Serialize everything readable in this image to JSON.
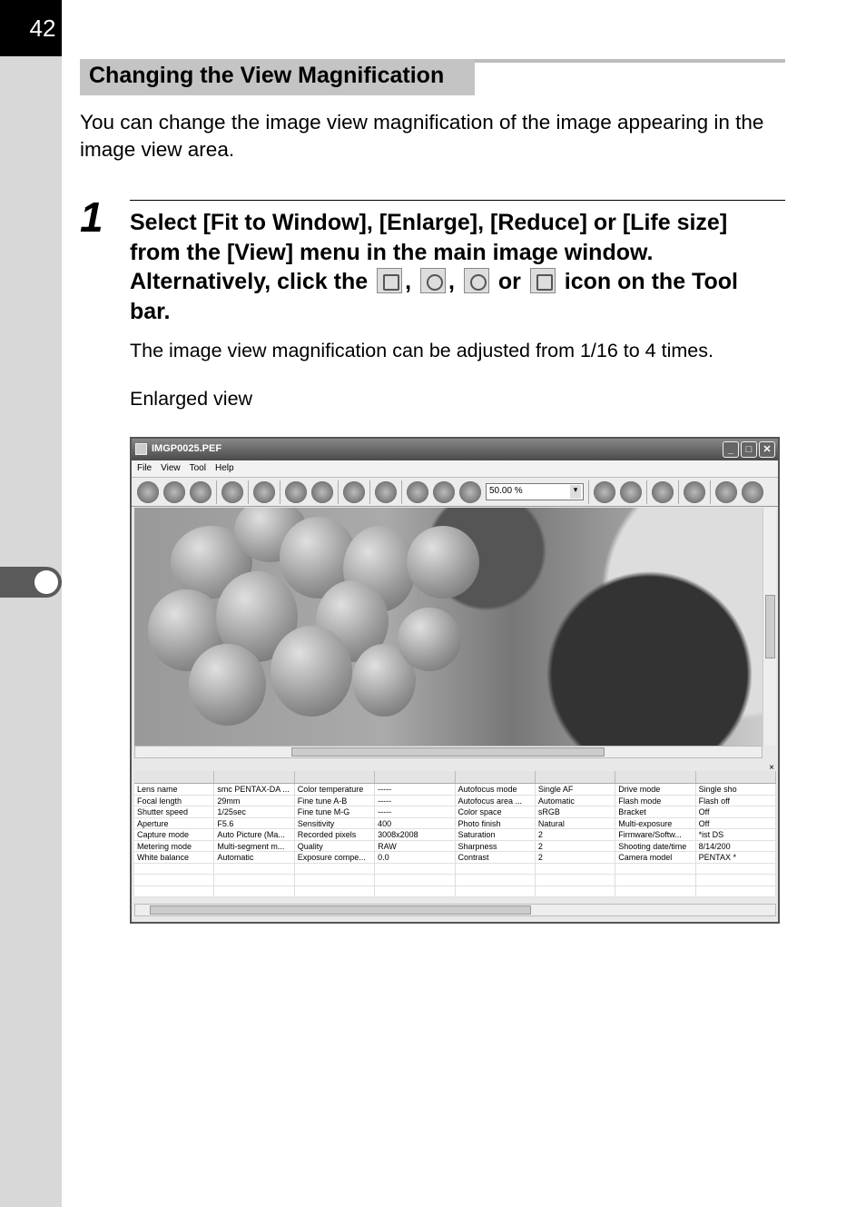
{
  "page_number": "42",
  "section_title": "Changing the View Magnification",
  "intro": "You can change the image view magnification of the image appearing in the image view area.",
  "step": {
    "number": "1",
    "line1": "Select [Fit to Window], [Enlarge], [Reduce] or [Life size] from the [View] menu in the main image window.",
    "line2a": "Alternatively, click the",
    "comma": ",",
    "or": "or",
    "line2b": "icon on the Tool bar.",
    "icons": [
      "fit-to-window-icon",
      "enlarge-icon",
      "reduce-icon",
      "life-size-icon"
    ]
  },
  "note": "The image view magnification can be adjusted from 1/16 to 4 times.",
  "caption": "Enlarged view",
  "window": {
    "title": "IMGP0025.PEF",
    "menu": [
      "File",
      "View",
      "Tool",
      "Help"
    ],
    "zoom_value": "50.00 %",
    "close": "✕",
    "maximize": "□",
    "minimize": "_",
    "panel_close": "×"
  },
  "table": {
    "rows": [
      [
        "Lens name",
        "smc PENTAX-DA ...",
        "Color temperature",
        "-----",
        "Autofocus mode",
        "Single AF",
        "Drive mode",
        "Single sho"
      ],
      [
        "Focal length",
        "29mm",
        "Fine tune A-B",
        "-----",
        "Autofocus area ...",
        "Automatic",
        "Flash mode",
        "Flash off"
      ],
      [
        "Shutter speed",
        "1/25sec",
        "Fine tune M-G",
        "-----",
        "Color space",
        "sRGB",
        "Bracket",
        "Off"
      ],
      [
        "Aperture",
        "F5.6",
        "Sensitivity",
        "400",
        "Photo finish",
        "Natural",
        "Multi-exposure",
        "Off"
      ],
      [
        "Capture mode",
        "Auto Picture (Ma...",
        "Recorded pixels",
        "3008x2008",
        "Saturation",
        "2",
        "Firmware/Softw...",
        "*ist DS"
      ],
      [
        "Metering mode",
        "Multi-segment m...",
        "Quality",
        "RAW",
        "Sharpness",
        "2",
        "Shooting date/time",
        "8/14/200"
      ],
      [
        "White balance",
        "Automatic",
        "Exposure compe...",
        "0.0",
        "Contrast",
        "2",
        "Camera model",
        "PENTAX *"
      ]
    ]
  }
}
